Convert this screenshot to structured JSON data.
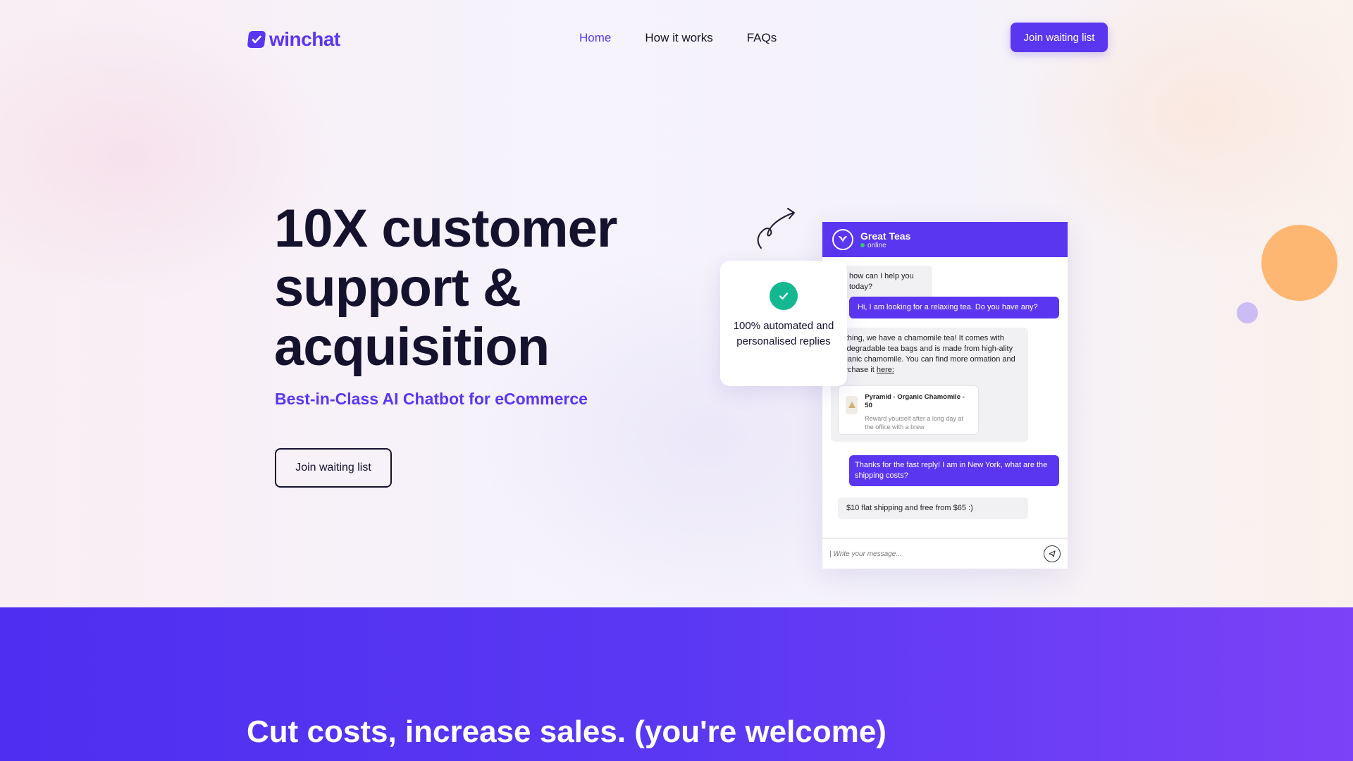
{
  "brand": {
    "name": "winchat",
    "color": "#5b36f0"
  },
  "nav": {
    "items": [
      {
        "label": "Home",
        "active": true
      },
      {
        "label": "How it works",
        "active": false
      },
      {
        "label": "FAQs",
        "active": false
      }
    ],
    "cta_label": "Join waiting list"
  },
  "hero": {
    "headline": "10X customer support & acquisition",
    "subhead": "Best-in-Class AI Chatbot for eCommerce",
    "cta_label": "Join waiting list"
  },
  "feature_card": {
    "icon": "check-icon",
    "text": "100% automated and personalised replies"
  },
  "chat": {
    "shop_name": "Great Teas",
    "status": "online",
    "messages": [
      {
        "from": "bot",
        "text": "how can I help you today?"
      },
      {
        "from": "user",
        "text": "Hi, I am looking for a relaxing tea. Do you have any?"
      },
      {
        "from": "bot",
        "text": "re thing, we have a chamomile tea! It comes with biodegradable tea bags and is made from high-ality organic chamomile. You can find more ormation and purchase it",
        "link": "here:"
      },
      {
        "from": "user",
        "text": "Thanks for the fast reply! I am in New York, what are the shipping costs?"
      },
      {
        "from": "bot",
        "text": "$10 flat shipping and free from $65 :)"
      }
    ],
    "product": {
      "name": "Pyramid - Organic Chamomile - 50",
      "description": "Reward yourself after a long day at the office with a brew"
    },
    "input_placeholder": "| Write your message..."
  },
  "section2": {
    "title": "Cut costs, increase sales. (you're welcome)"
  },
  "colors": {
    "accent": "#5b36f0",
    "success": "#14b890",
    "orange": "#fdb772",
    "lilac": "#cbbcf3"
  }
}
